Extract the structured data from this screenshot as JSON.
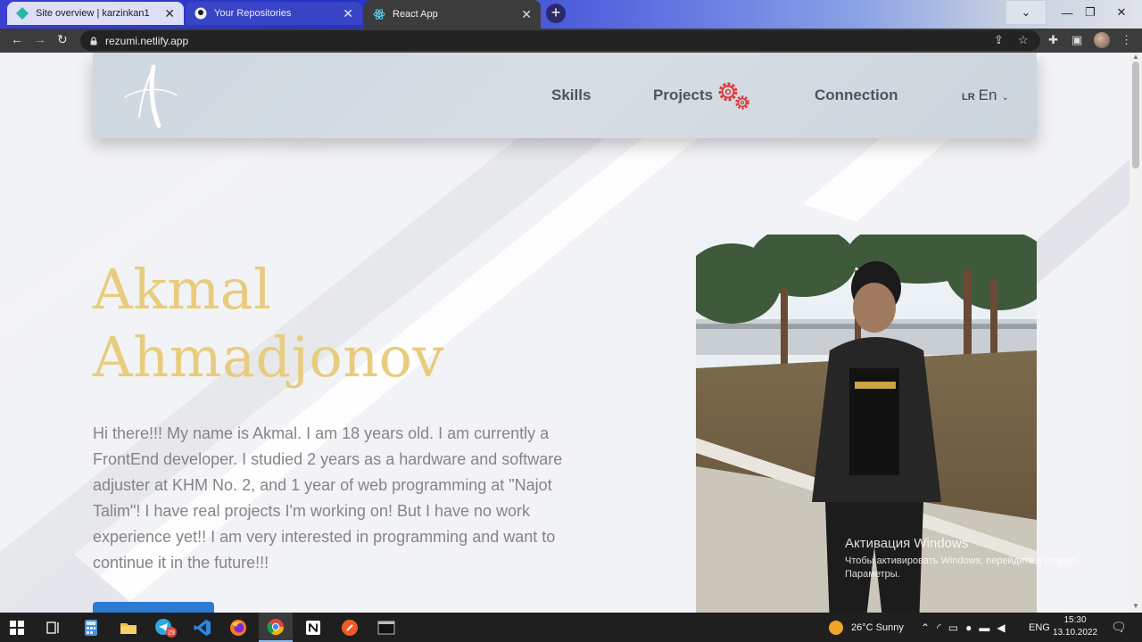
{
  "browser": {
    "tabs": [
      {
        "title": "Site overview | karzinkan1"
      },
      {
        "title": "Your Repositories"
      },
      {
        "title": "React App"
      }
    ],
    "url": "rezumi.netlify.app"
  },
  "nav": {
    "items": [
      {
        "label": "Skills"
      },
      {
        "label": "Projects"
      },
      {
        "label": "Connection"
      }
    ],
    "lang_prefix": "LR",
    "lang": "En"
  },
  "hero": {
    "name_line1": "Akmal",
    "name_line2": "Ahmadjonov",
    "bio": "Hi there!!! My name is Akmal. I am 18 years old. I am currently a FrontEnd developer. I studied 2 years as a hardware and software adjuster at KHM No. 2, and 1 year of web programming at \"Najot Talim\"! I have real projects I'm working on! But I have no work experience yet!! I am very interested in programming and want to continue it in the future!!!"
  },
  "watermark": {
    "line1": "Активация Windows",
    "line2": "Чтобы активировать Windows, перейдите в раздел",
    "line3": "Параметры."
  },
  "taskbar": {
    "weather": "26°C  Sunny",
    "lang": "ENG",
    "time": "15:30",
    "date": "13.10.2022",
    "telegram_badge": "29"
  },
  "colors": {
    "accent_name": "#e8cc7e",
    "nav_text": "#4b5561",
    "button": "#2b7bd2"
  }
}
